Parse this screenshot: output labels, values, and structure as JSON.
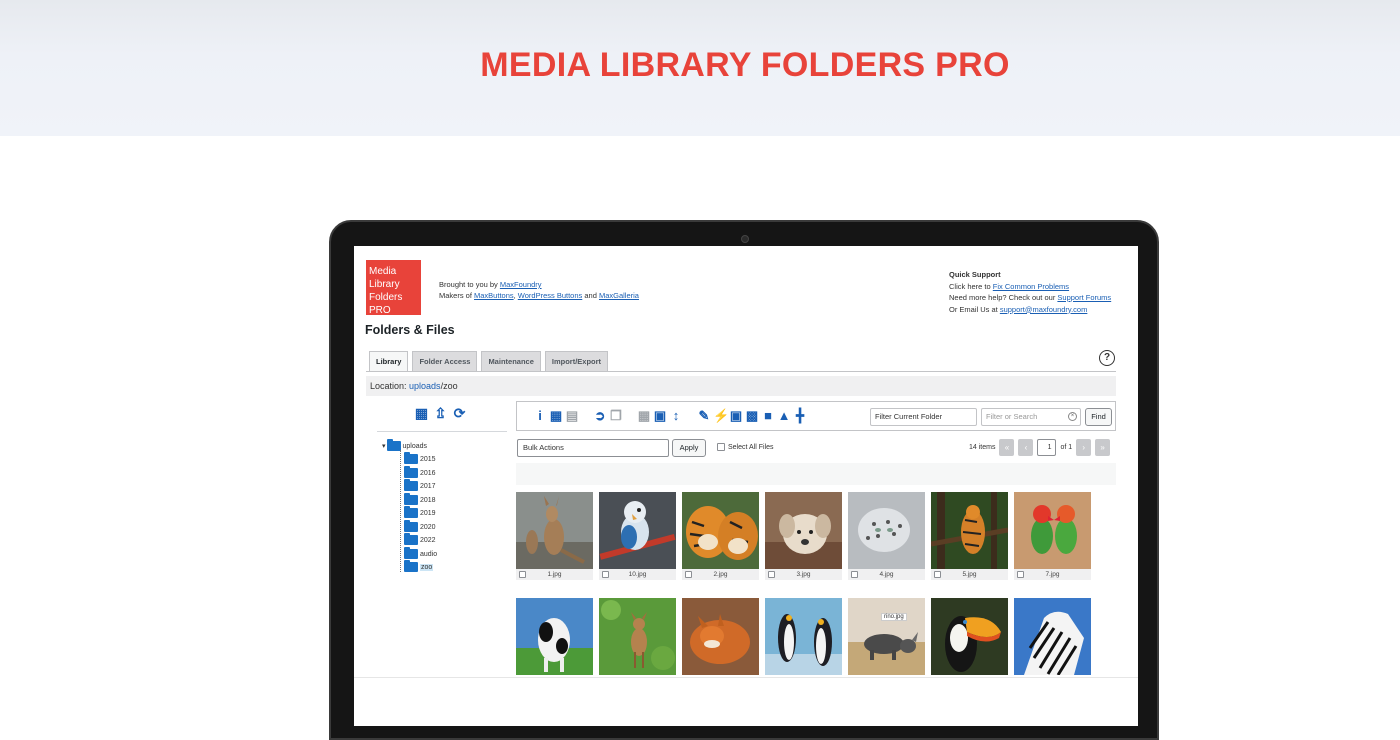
{
  "hero": {
    "title": "MEDIA LIBRARY FOLDERS PRO"
  },
  "plugin": {
    "logo_lines": [
      "Media",
      "Library",
      "Folders PRO"
    ],
    "brought_prefix": "Brought to you by ",
    "brought_link": "MaxFoundry",
    "makers_prefix": "Makers of ",
    "makers_link1": "MaxButtons",
    "makers_sep": ", ",
    "makers_link2": "WordPress Buttons",
    "makers_and": " and ",
    "makers_link3": "MaxGalleria"
  },
  "support": {
    "title": "Quick Support",
    "line1_prefix": "Click here to ",
    "line1_link": "Fix Common Problems",
    "line2_prefix": "Need more help? Check out our ",
    "line2_link": "Support Forums",
    "line3_prefix": "Or Email Us at ",
    "line3_link": "support@maxfoundry.com"
  },
  "page_title": "Folders & Files",
  "tabs": [
    {
      "label": "Library",
      "active": true
    },
    {
      "label": "Folder Access",
      "active": false
    },
    {
      "label": "Maintenance",
      "active": false
    },
    {
      "label": "Import/Export",
      "active": false
    }
  ],
  "location": {
    "label": "Location: ",
    "link": "uploads",
    "rest": "/zoo"
  },
  "tree": {
    "root": "uploads",
    "folders": [
      "2015",
      "2016",
      "2017",
      "2018",
      "2019",
      "2020",
      "2022",
      "audio",
      "zoo"
    ],
    "selected": "zoo"
  },
  "toolbar": {
    "filter_label": "Filter Current Folder",
    "search_placeholder": "Filter or Search",
    "find_label": "Find"
  },
  "bulk": {
    "select_value": "Bulk Actions",
    "apply_label": "Apply",
    "select_all_label": "Select All Files"
  },
  "pager": {
    "count": "14 items",
    "page": "1",
    "of": "of 1"
  },
  "files": [
    {
      "name": "1.jpg",
      "animal": "kangaroo"
    },
    {
      "name": "10.jpg",
      "animal": "parrot"
    },
    {
      "name": "2.jpg",
      "animal": "tiger"
    },
    {
      "name": "3.jpg",
      "animal": "puppy"
    },
    {
      "name": "4.jpg",
      "animal": "snow-leopard"
    },
    {
      "name": "5.jpg",
      "animal": "tiger-jungle"
    },
    {
      "name": "7.jpg",
      "animal": "lovebirds"
    },
    {
      "name": "",
      "animal": "cow"
    },
    {
      "name": "",
      "animal": "fawn"
    },
    {
      "name": "",
      "animal": "fox"
    },
    {
      "name": "",
      "animal": "penguins"
    },
    {
      "name": "",
      "animal": "rhino",
      "hover_label": "rino.jpg"
    },
    {
      "name": "",
      "animal": "toucan"
    },
    {
      "name": "",
      "animal": "zebra"
    }
  ],
  "colors": {
    "brand_red": "#e8433a",
    "link_blue": "#1a5fb4",
    "folder_blue": "#1a73c8"
  }
}
